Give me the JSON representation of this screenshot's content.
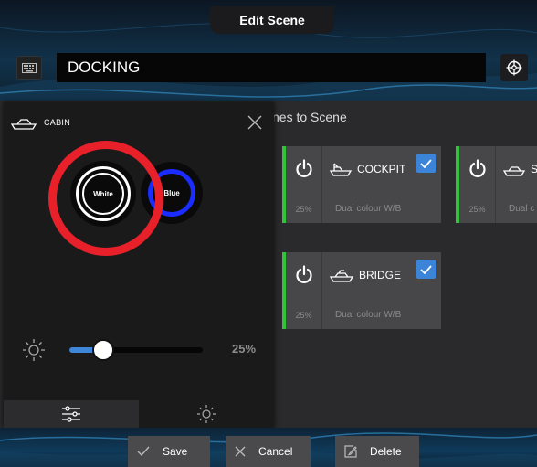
{
  "header": {
    "title": "Edit Scene"
  },
  "scene": {
    "name": "DOCKING"
  },
  "section": {
    "heading": "nes to Scene"
  },
  "zones": [
    {
      "name": "COCKPIT",
      "level": "25%",
      "mode": "Dual colour W/B",
      "checked": true
    },
    {
      "name": "S",
      "level": "25%",
      "mode": "Dual c",
      "checked": false
    },
    {
      "name": "BRIDGE",
      "level": "25%",
      "mode": "Dual colour W/B",
      "checked": true
    }
  ],
  "panel": {
    "title": "CABIN",
    "colors": [
      {
        "label": "White",
        "accent": "#ffffff",
        "selected": true
      },
      {
        "label": "Blue",
        "accent": "#1a2cff",
        "selected": false
      }
    ],
    "brightness_label": "25%",
    "brightness_value": 0.25
  },
  "footer": {
    "save": "Save",
    "cancel": "Cancel",
    "delete": "Delete"
  },
  "colors": {
    "accent_green": "#33c23a",
    "accent_blue": "#3c84d8",
    "annotation_red": "#e8202a"
  }
}
